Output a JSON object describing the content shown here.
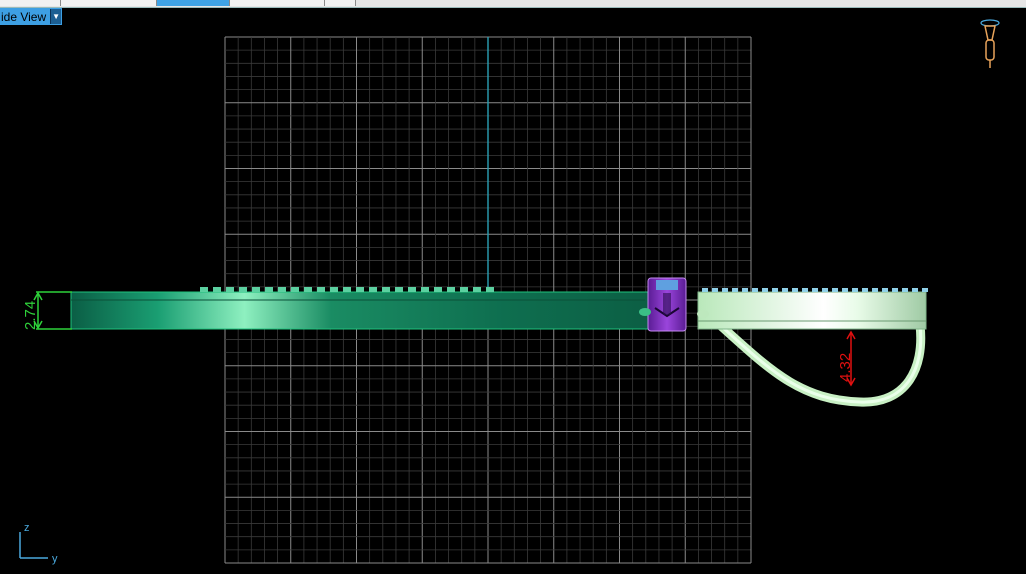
{
  "tabs": [
    {
      "label": "p",
      "active": false
    },
    {
      "label": "",
      "active": false
    },
    {
      "label": "",
      "active": true
    },
    {
      "label": "",
      "active": false
    },
    {
      "label": "",
      "active": false
    }
  ],
  "view": {
    "label": "ide View",
    "dropdown_icon": "chevron-down-icon"
  },
  "dimensions": {
    "band_height": "2.74",
    "shank_depth": "4.32"
  },
  "axes": {
    "vertical": "z",
    "horizontal": "y"
  },
  "colors": {
    "grid": "#8c8c8c",
    "band": "#12905f",
    "dim_green": "#2ed23a",
    "dim_red": "#e01010",
    "prong": "#7a2dbd",
    "axis_blue": "#4aa9dd",
    "camera": "#e8a35a"
  }
}
